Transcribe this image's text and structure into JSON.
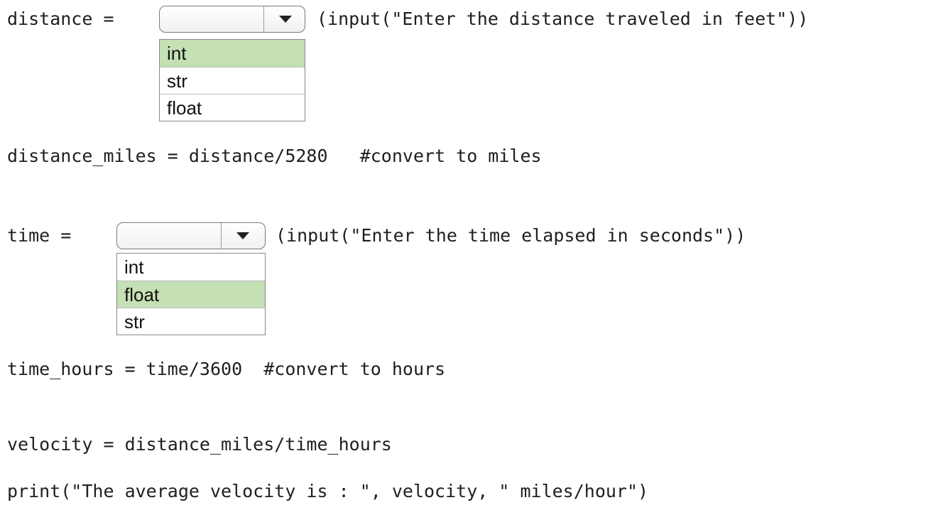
{
  "lines": {
    "distance_prefix": "distance = ",
    "distance_suffix": "(input(\"Enter the distance traveled in feet\"))",
    "distance_miles": "distance_miles = distance/5280   #convert to miles",
    "time_prefix": "time = ",
    "time_suffix": "(input(\"Enter the time elapsed in seconds\"))",
    "time_hours": "time_hours = time/3600  #convert to hours",
    "velocity": "velocity = distance_miles/time_hours",
    "print": "print(\"The average velocity is : \", velocity, \" miles/hour\")"
  },
  "dropdown1": {
    "selected_value": "",
    "options": [
      "int",
      "str",
      "float"
    ],
    "highlighted_option": "int",
    "highlight_color": "#c5e0b4"
  },
  "dropdown2": {
    "selected_value": "",
    "options": [
      "int",
      "float",
      "str"
    ],
    "highlighted_option": "float",
    "highlight_color": "#c5e0b4"
  },
  "icons": {
    "dropdown_arrow": "chevron-down-icon"
  }
}
